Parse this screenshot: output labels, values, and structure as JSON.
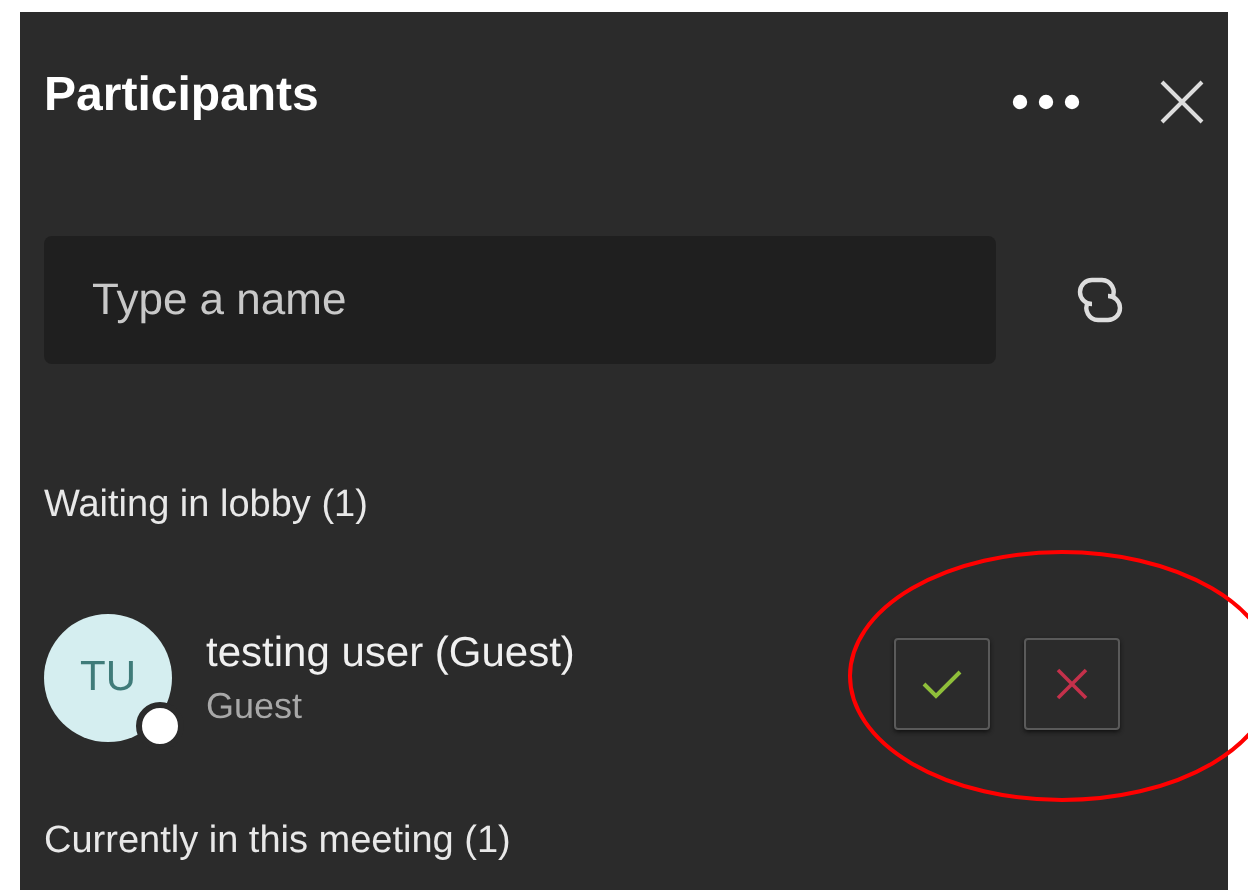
{
  "panel": {
    "title": "Participants"
  },
  "search": {
    "placeholder": "Type a name"
  },
  "lobby": {
    "heading": "Waiting in lobby (1)",
    "people": [
      {
        "initials": "TU",
        "name": "testing user (Guest)",
        "role": "Guest"
      }
    ]
  },
  "meeting": {
    "heading": "Currently in this meeting (1)"
  },
  "annotation": {
    "kind": "ellipse",
    "color": "#ff0000"
  }
}
